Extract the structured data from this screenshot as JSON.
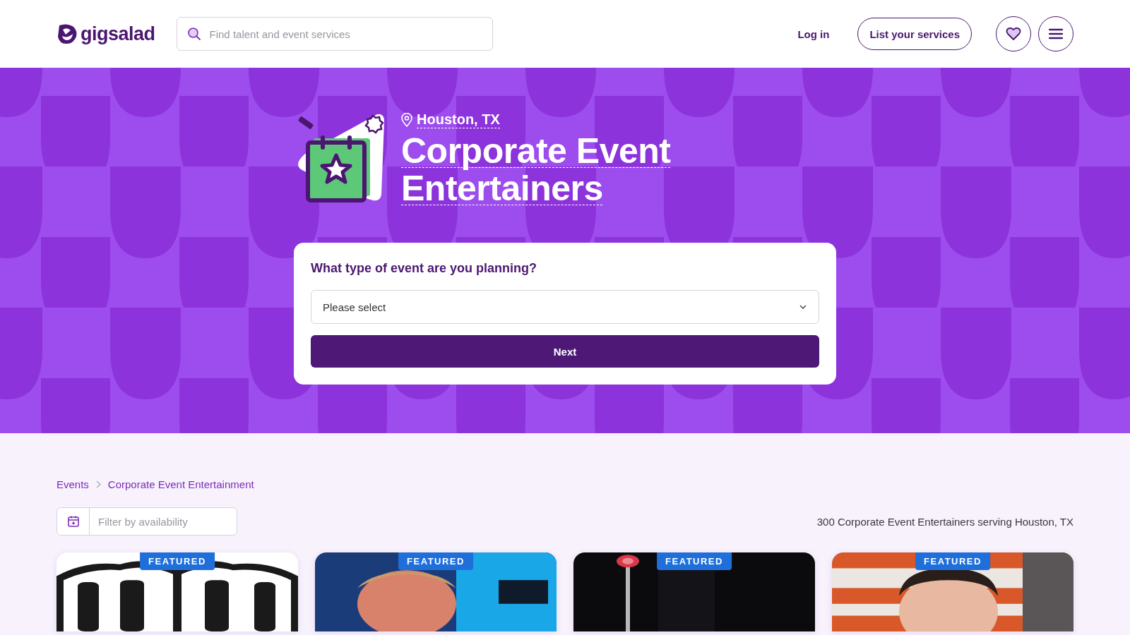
{
  "header": {
    "logo": "gigsalad",
    "search": {
      "placeholder": "Find talent and event services"
    },
    "login": "Log in",
    "list_services": "List your services"
  },
  "hero": {
    "location": "Houston, TX",
    "title": "Corporate Event Entertainers",
    "form": {
      "question": "What type of event are you planning?",
      "select": {
        "value": "Please select"
      },
      "button": "Next"
    }
  },
  "breadcrumbs": [
    {
      "label": "Events"
    },
    {
      "label": "Corporate Event Entertainment"
    }
  ],
  "filter": {
    "placeholder": "Filter by availability"
  },
  "results_count": "300 Corporate Event Entertainers serving Houston, TX",
  "cards": [
    {
      "badge": "FEATURED",
      "kind": "picture"
    },
    {
      "badge": "FEATURED",
      "kind": "picture"
    },
    {
      "badge": "FEATURED",
      "kind": "picture"
    },
    {
      "badge": "FEATURED",
      "kind": "picture"
    }
  ]
}
